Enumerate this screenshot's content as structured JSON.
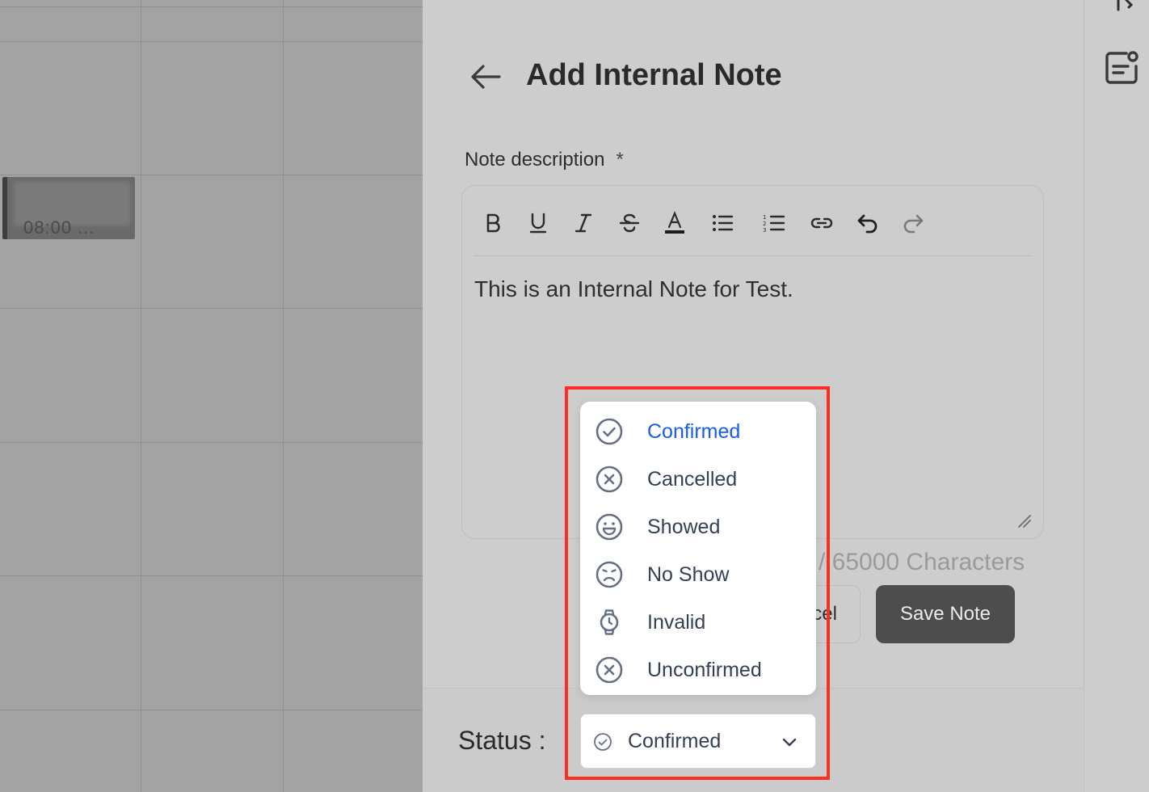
{
  "calendar": {
    "event_text": "08:00 ..."
  },
  "drawer": {
    "title": "Add Internal Note",
    "field_label": "Note description",
    "required_marker": "*",
    "editor_text": "This is an Internal Note for Test.",
    "toolbar_icons": [
      "bold-icon",
      "underline-icon",
      "italic-icon",
      "strikethrough-icon",
      "text-color-icon",
      "bullet-list-icon",
      "numbered-list-icon",
      "link-icon",
      "undo-icon",
      "redo-icon"
    ],
    "char_count": "/ 65000 Characters",
    "cancel_label": "Cancel",
    "save_label": "Save Note",
    "status_label": "Status :"
  },
  "status_dropdown": {
    "selected": "Confirmed",
    "accent_color": "#155eef",
    "options": [
      {
        "label": "Confirmed",
        "icon": "check-circle-icon"
      },
      {
        "label": "Cancelled",
        "icon": "x-circle-icon"
      },
      {
        "label": "Showed",
        "icon": "happy-face-icon"
      },
      {
        "label": "No Show",
        "icon": "sad-face-icon"
      },
      {
        "label": "Invalid",
        "icon": "watch-icon"
      },
      {
        "label": "Unconfirmed",
        "icon": "x-circle-icon"
      }
    ]
  },
  "colors": {
    "highlight_border": "#ff2d20",
    "save_button_bg": "#4d4d4d"
  }
}
